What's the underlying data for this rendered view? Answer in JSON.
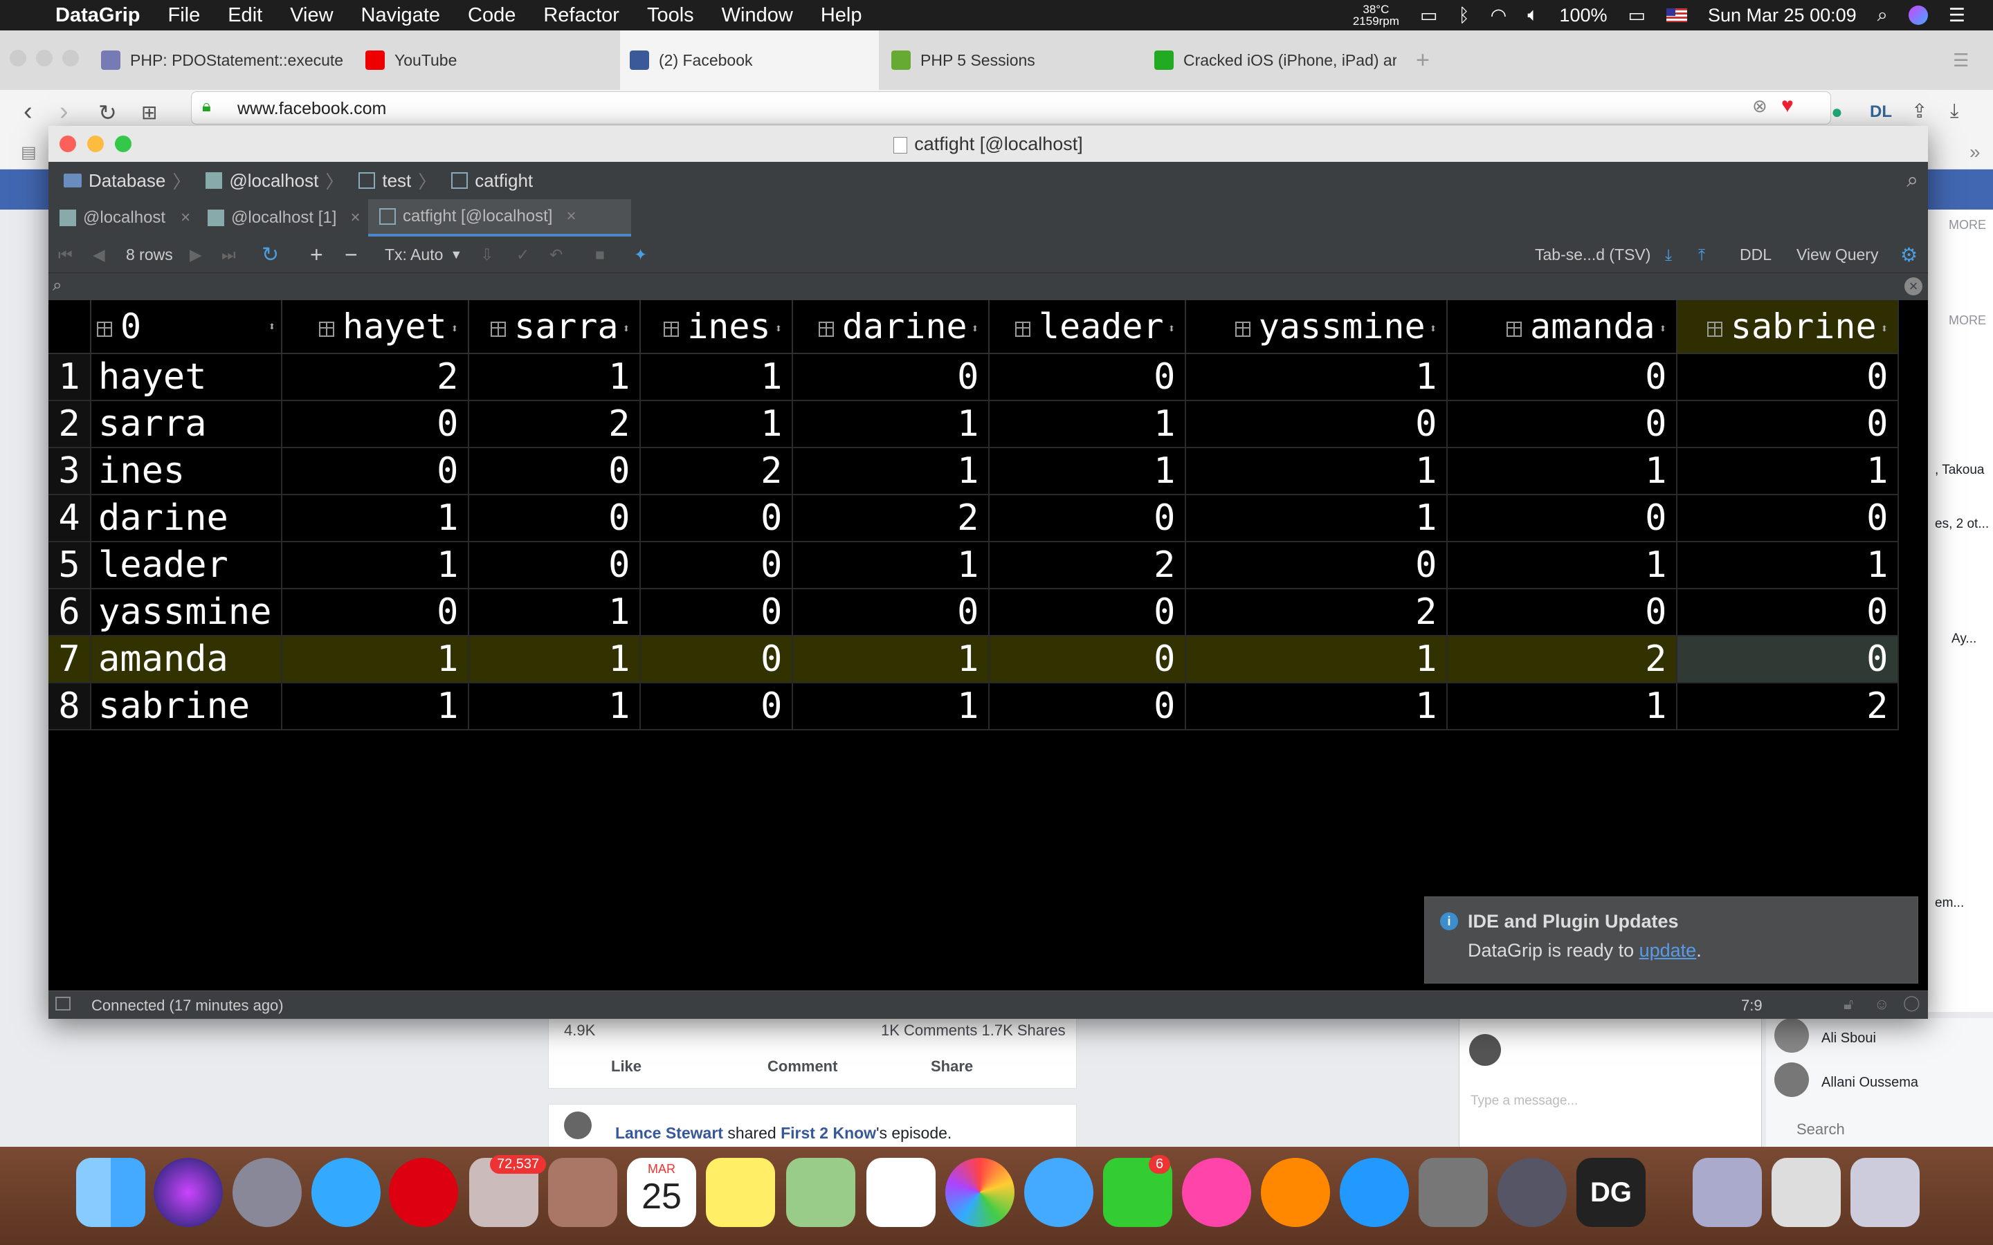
{
  "menubar": {
    "app": "DataGrip",
    "items": [
      "File",
      "Edit",
      "View",
      "Navigate",
      "Code",
      "Refactor",
      "Tools",
      "Window",
      "Help"
    ],
    "temp": "38°C",
    "rpm": "2159rpm",
    "battery": "100%",
    "clock": "Sun Mar 25  00:09"
  },
  "browser": {
    "tabs": [
      {
        "label": "PHP: PDOStatement::execute"
      },
      {
        "label": "YouTube"
      },
      {
        "label": "(2) Facebook"
      },
      {
        "label": "PHP 5 Sessions"
      },
      {
        "label": "Cracked iOS (iPhone, iPad) ar"
      }
    ],
    "url": "www.facebook.com"
  },
  "ide": {
    "window_title": "catfight [@localhost]",
    "breadcrumbs": [
      "Database",
      "@localhost",
      "test",
      "catfight"
    ],
    "editor_tabs": [
      "@localhost",
      "@localhost [1]",
      "catfight [@localhost]"
    ],
    "toolbar": {
      "rows": "8 rows",
      "tx": "Tx: Auto",
      "export_format": "Tab-se...d (TSV)",
      "ddl": "DDL",
      "view_query": "View Query"
    },
    "columns": [
      "0",
      "hayet",
      "sarra",
      "ines",
      "darine",
      "leader",
      "yassmine",
      "amanda",
      "sabrine"
    ],
    "rows": [
      [
        "1",
        "hayet",
        "2",
        "1",
        "1",
        "0",
        "0",
        "1",
        "0",
        "0"
      ],
      [
        "2",
        "sarra",
        "0",
        "2",
        "1",
        "1",
        "1",
        "0",
        "0",
        "0"
      ],
      [
        "3",
        "ines",
        "0",
        "0",
        "2",
        "1",
        "1",
        "1",
        "1",
        "1"
      ],
      [
        "4",
        "darine",
        "1",
        "0",
        "0",
        "2",
        "0",
        "1",
        "0",
        "0"
      ],
      [
        "5",
        "leader",
        "1",
        "0",
        "0",
        "1",
        "2",
        "0",
        "1",
        "1"
      ],
      [
        "6",
        "yassmine",
        "0",
        "1",
        "0",
        "0",
        "0",
        "2",
        "0",
        "0"
      ],
      [
        "7",
        "amanda",
        "1",
        "1",
        "0",
        "1",
        "0",
        "1",
        "2",
        "0"
      ],
      [
        "8",
        "sabrine",
        "1",
        "1",
        "0",
        "1",
        "0",
        "1",
        "1",
        "2"
      ]
    ],
    "notification": {
      "title": "IDE and Plugin Updates",
      "text": "DataGrip is ready to ",
      "link": "update",
      "tail": "."
    },
    "status": "Connected (17 minutes ago)",
    "position": "7:9"
  },
  "facebook": {
    "reactions": "4.9K",
    "comments_shares": "1K Comments  1.7K Shares",
    "like": "Like",
    "comment": "Comment",
    "share": "Share",
    "post_author": "Lance Stewart",
    "post_text": " shared ",
    "post_link": "First 2 Know",
    "post_tail": "'s episode.",
    "more1": "MORE",
    "more2": "MORE",
    "chat_names": [
      "Ali Sboui",
      "Allani Oussema"
    ],
    "side_snippets": [
      ", Takoua",
      "es, 2 ot...",
      "Ay...",
      "em..."
    ],
    "message_placeholder": "Type a message...",
    "search": "Search"
  },
  "dock": {
    "mail_badge": "72,537",
    "facetime_badge": "6",
    "calendar_month": "MAR",
    "calendar_day": "25"
  }
}
